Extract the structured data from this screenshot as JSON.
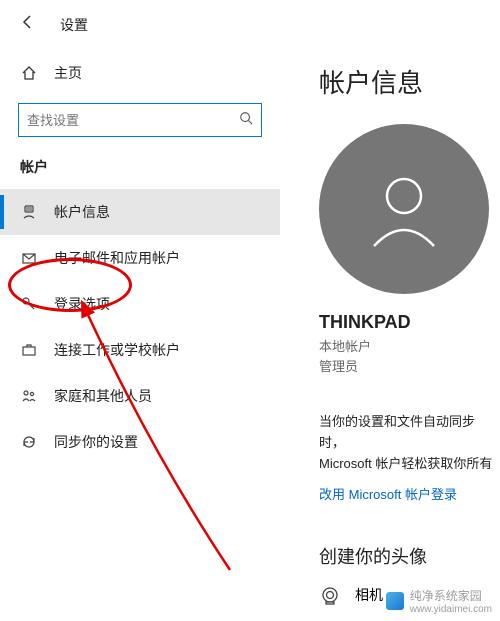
{
  "header": {
    "title": "设置"
  },
  "sidebar": {
    "home_label": "主页",
    "search_placeholder": "查找设置",
    "section": "帐户",
    "items": [
      {
        "icon": "user",
        "label": "帐户信息",
        "selected": true
      },
      {
        "icon": "mail",
        "label": "电子邮件和应用帐户",
        "selected": false
      },
      {
        "icon": "key",
        "label": "登录选项",
        "selected": false
      },
      {
        "icon": "briefcase",
        "label": "连接工作或学校帐户",
        "selected": false
      },
      {
        "icon": "family",
        "label": "家庭和其他人员",
        "selected": false
      },
      {
        "icon": "sync",
        "label": "同步你的设置",
        "selected": false
      }
    ]
  },
  "content": {
    "heading": "帐户信息",
    "account_name": "THINKPAD",
    "account_type1": "本地帐户",
    "account_type2": "管理员",
    "sync_line1": "当你的设置和文件自动同步时，",
    "sync_line2": "Microsoft 帐户轻松获取你所有",
    "ms_link": "改用 Microsoft 帐户登录",
    "create_avatar": "创建你的头像",
    "camera_label": "相机"
  },
  "watermark": {
    "text1": "纯净系统家园",
    "text2": "www.yidaimei.com"
  }
}
